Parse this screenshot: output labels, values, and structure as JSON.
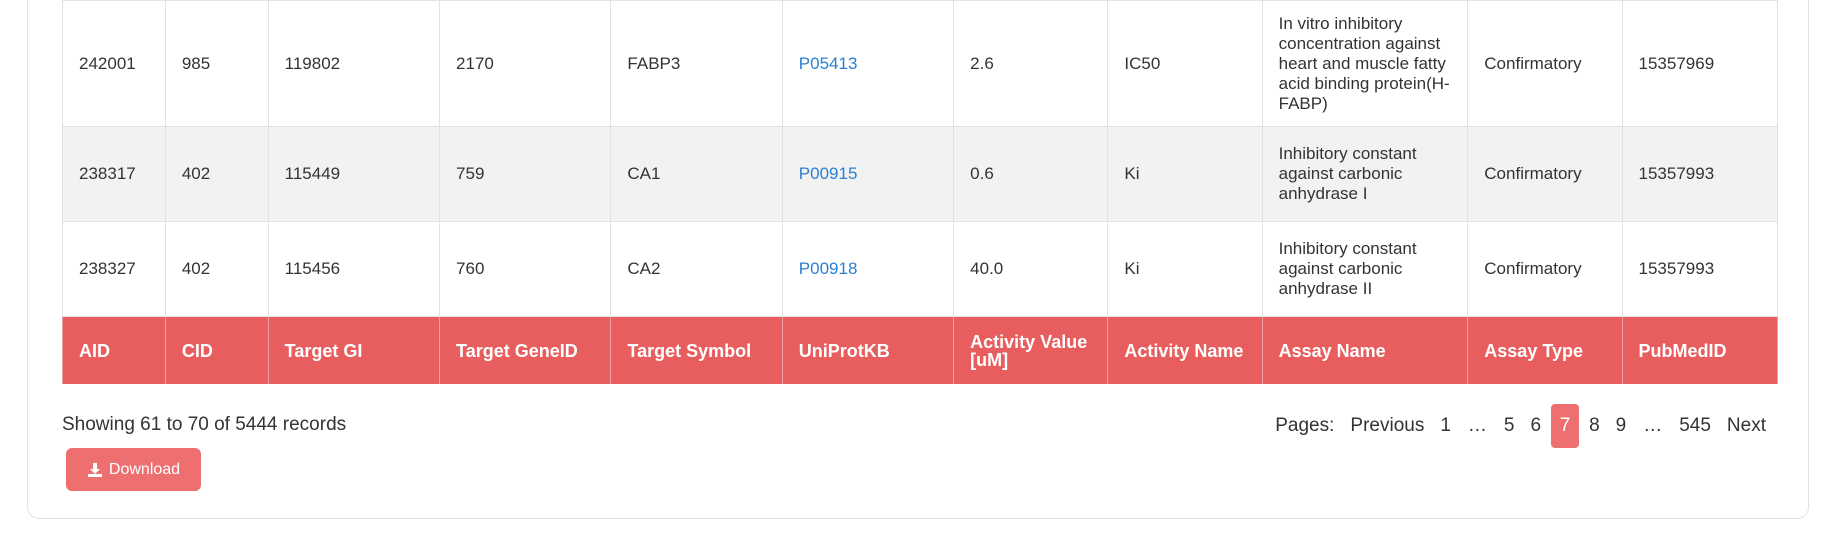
{
  "table": {
    "columns": [
      "AID",
      "CID",
      "Target GI",
      "Target GeneID",
      "Target Symbol",
      "UniProtKB",
      "Activity Value [uM]",
      "Activity Name",
      "Assay Name",
      "Assay Type",
      "PubMedID"
    ],
    "rows": [
      {
        "aid": "242001",
        "cid": "985",
        "target_gi": "119802",
        "target_geneid": "2170",
        "target_symbol": "FABP3",
        "uniprot": "P05413",
        "activity_value": "2.6",
        "activity_name": "IC50",
        "assay_name": "In vitro inhibitory concentration against heart and muscle fatty acid binding protein(H-FABP)",
        "assay_type": "Confirmatory",
        "pubmed": "15357969"
      },
      {
        "aid": "238317",
        "cid": "402",
        "target_gi": "115449",
        "target_geneid": "759",
        "target_symbol": "CA1",
        "uniprot": "P00915",
        "activity_value": "0.6",
        "activity_name": "Ki",
        "assay_name": "Inhibitory constant against carbonic anhydrase I",
        "assay_type": "Confirmatory",
        "pubmed": "15357993"
      },
      {
        "aid": "238327",
        "cid": "402",
        "target_gi": "115456",
        "target_geneid": "760",
        "target_symbol": "CA2",
        "uniprot": "P00918",
        "activity_value": "40.0",
        "activity_name": "Ki",
        "assay_name": "Inhibitory constant against carbonic anhydrase II",
        "assay_type": "Confirmatory",
        "pubmed": "15357993"
      }
    ]
  },
  "footer": {
    "records_text": "Showing 61 to 70 of 5444 records",
    "download_label": "Download",
    "download_icon": "download-icon"
  },
  "pagination": {
    "label": "Pages:",
    "previous": "Previous",
    "next": "Next",
    "pages": [
      "1",
      "…",
      "5",
      "6",
      "7",
      "8",
      "9",
      "…",
      "545"
    ],
    "current": "7"
  },
  "colors": {
    "accent": "#e85e5e",
    "active_page": "#ee6f6f",
    "link": "#2a7fd4",
    "stripe": "#f2f2f2"
  }
}
